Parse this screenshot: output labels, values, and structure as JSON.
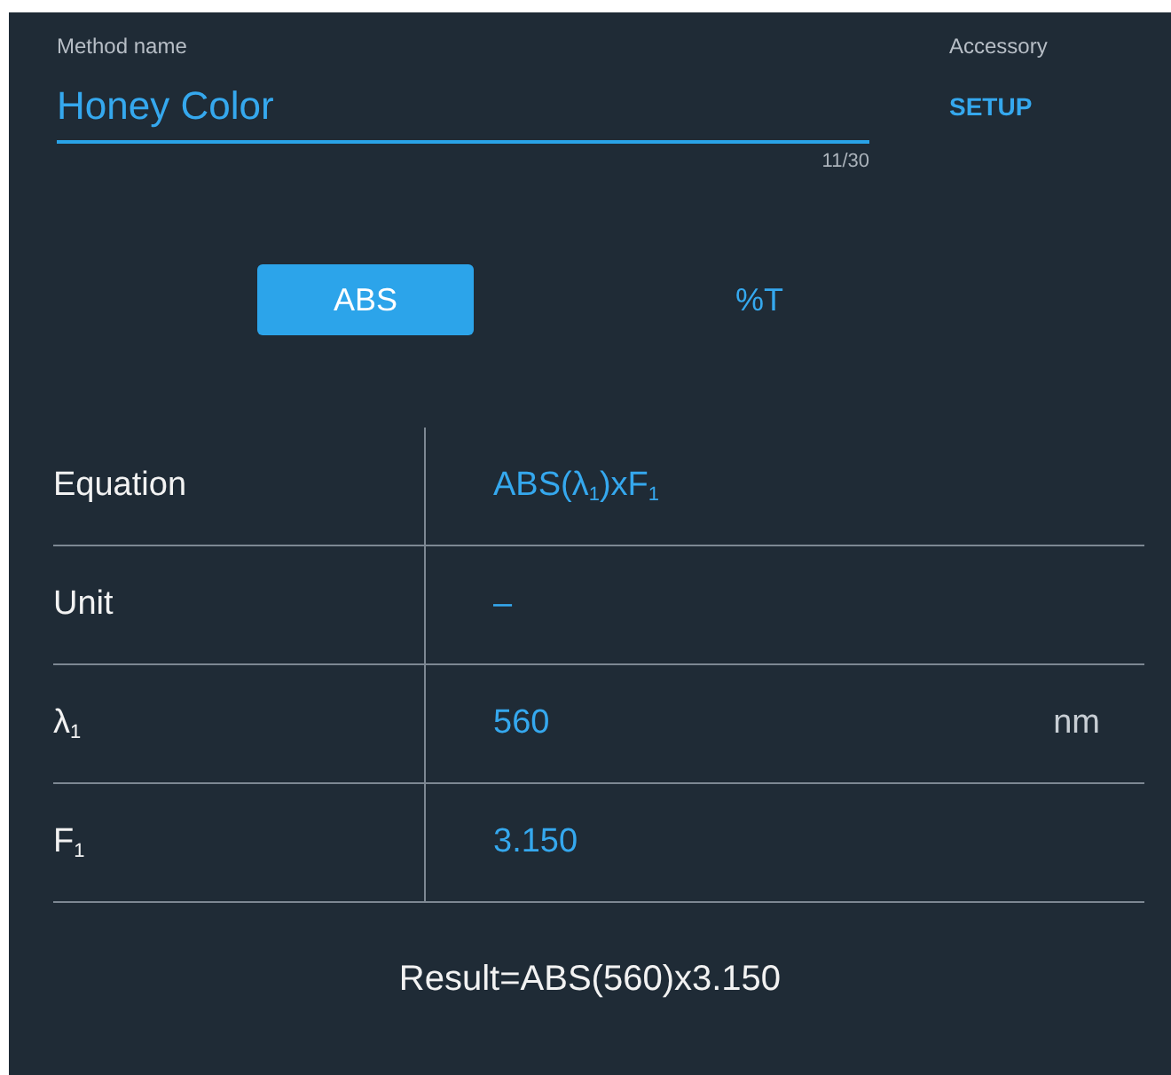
{
  "method_name": {
    "label": "Method name",
    "value": "Honey Color",
    "counter": "11/30"
  },
  "accessory": {
    "label": "Accessory",
    "action": "SETUP"
  },
  "modes": [
    {
      "label": "ABS",
      "selected": true
    },
    {
      "label": "%T",
      "selected": false
    }
  ],
  "parameters": [
    {
      "name": "Equation",
      "value": "ABS(λ$_{1}$)xF$_{1}$"
    },
    {
      "name": "Unit",
      "value": "–"
    },
    {
      "name": "λ$_{1}$",
      "value": "560",
      "unit": "nm"
    },
    {
      "name": "F$_{1}$",
      "value": "3.150"
    }
  ],
  "result": "Result=ABS(560)x3.150"
}
